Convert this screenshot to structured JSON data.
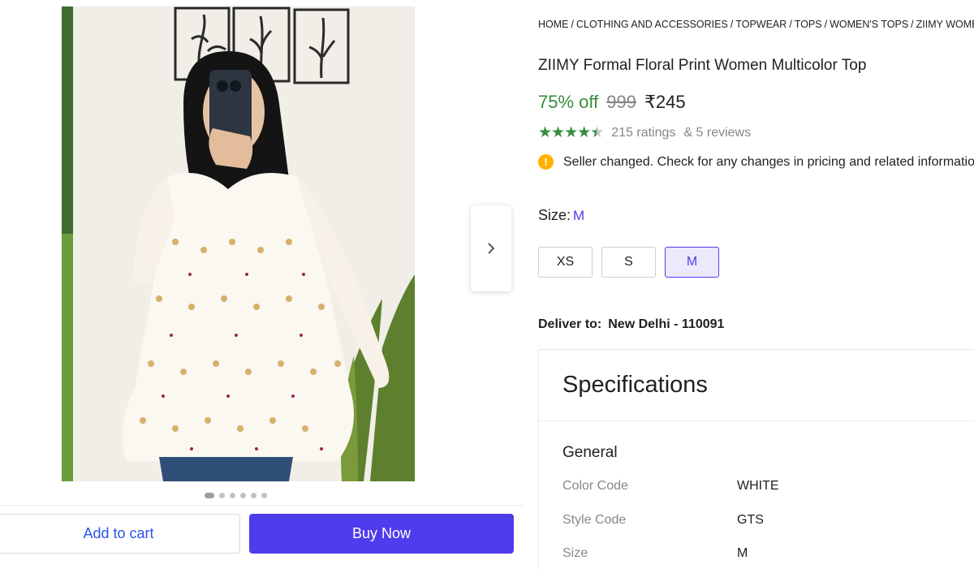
{
  "gallery": {
    "dots_count": 6,
    "active_dot": 0,
    "next_icon": "chevron-right-icon"
  },
  "actions": {
    "add_to_cart": "Add to cart",
    "buy_now": "Buy Now"
  },
  "breadcrumb": [
    "HOME",
    "CLOTHING AND ACCESSORIES",
    "TOPWEAR",
    "TOPS",
    "WOMEN'S TOPS",
    "ZIIMY WOMEN"
  ],
  "product": {
    "title": "ZIIMY Formal Floral Print Women Multicolor Top",
    "discount": "75% off",
    "mrp": "999",
    "price": "₹245",
    "rating_value": 4.3,
    "ratings": "215 ratings",
    "reviews": "& 5 reviews",
    "notice": "Seller changed. Check for any changes in pricing and related information"
  },
  "size": {
    "label": "Size:",
    "selected": "M",
    "options": [
      "XS",
      "S",
      "M"
    ]
  },
  "delivery": {
    "label": "Deliver to:",
    "location": "New Delhi - 110091"
  },
  "specifications": {
    "title": "Specifications",
    "group": "General",
    "rows": [
      {
        "key": "Color Code",
        "value": "WHITE"
      },
      {
        "key": "Style Code",
        "value": "GTS"
      },
      {
        "key": "Size",
        "value": "M"
      }
    ]
  },
  "colors": {
    "accent": "#4f3cec",
    "discount_green": "#388e3c",
    "muted": "#878787"
  }
}
